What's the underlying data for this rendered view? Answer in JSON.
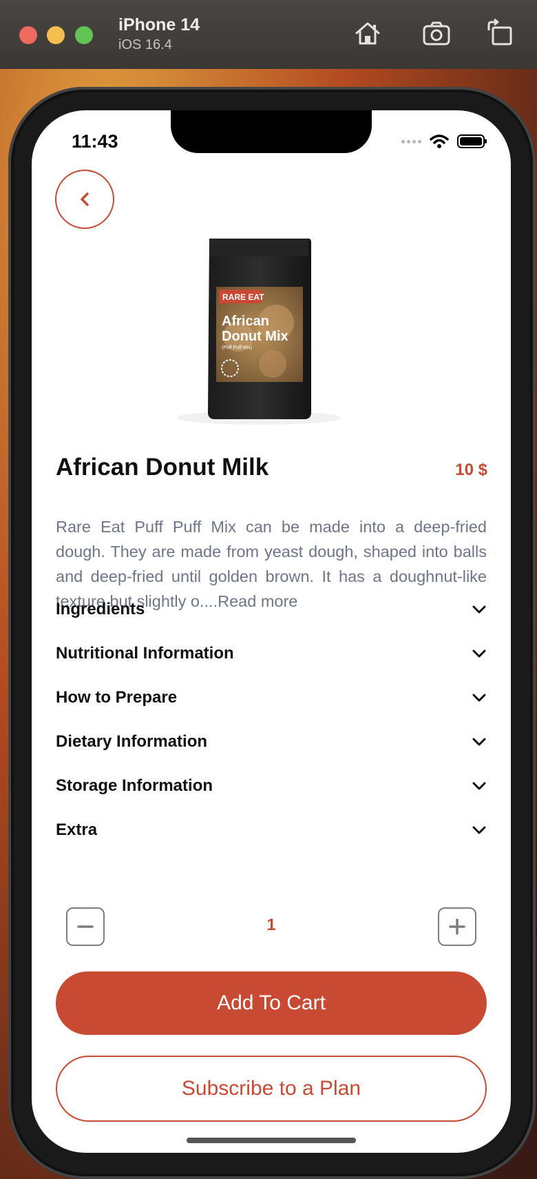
{
  "simulator": {
    "device_name": "iPhone 14",
    "os_version": "iOS 16.4",
    "icons": [
      "home-icon",
      "screenshot-icon",
      "rotate-icon"
    ]
  },
  "status_bar": {
    "time": "11:43"
  },
  "product": {
    "name": "African Donut Milk",
    "price": "10 $",
    "description": "Rare Eat Puff Puff Mix can be made into a deep-fried dough. They are made from yeast dough, shaped into balls and deep-fried until golden brown. It has a doughnut-like texture but slightly o....Read more",
    "image": {
      "brand": "RARE EAT",
      "title_line1": "African",
      "title_line2": "Donut Mix",
      "subtitle": "(Puff Puff Mix)"
    }
  },
  "accordion": [
    {
      "label": "Ingredients"
    },
    {
      "label": "Nutritional Information"
    },
    {
      "label": "How to Prepare"
    },
    {
      "label": "Dietary Information"
    },
    {
      "label": "Storage Information"
    },
    {
      "label": "Extra"
    }
  ],
  "quantity": {
    "value": "1"
  },
  "buttons": {
    "add_to_cart": "Add To Cart",
    "subscribe": "Subscribe to a Plan"
  },
  "colors": {
    "accent": "#c94a33",
    "text_primary": "#111111",
    "text_secondary": "#6d7689"
  }
}
